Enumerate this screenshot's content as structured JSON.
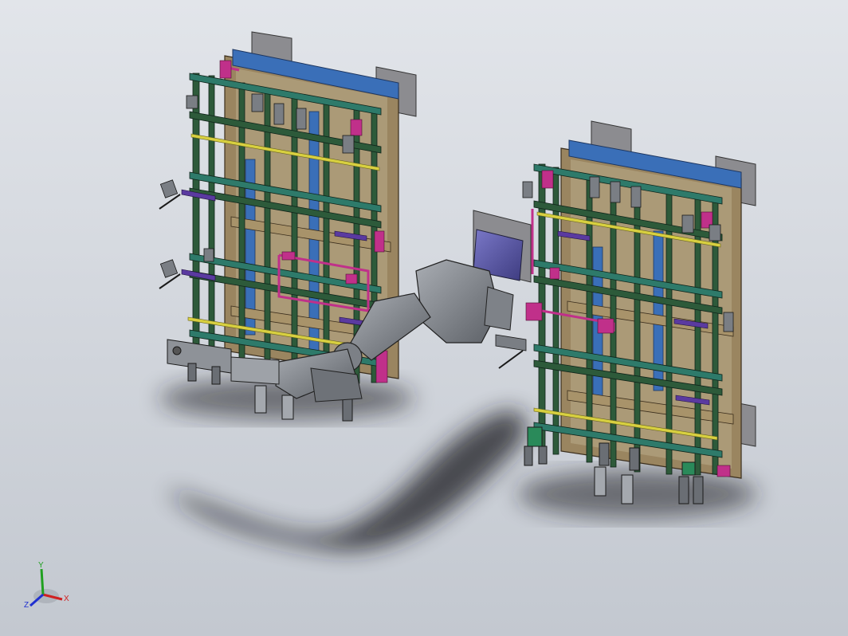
{
  "viewport": {
    "background_top": "#e2e5ea",
    "background_bottom": "#c3c8d0"
  },
  "colors": {
    "frame_green": "#2d5a3a",
    "frame_teal": "#2e7a6a",
    "beam_blue": "#3a6fb8",
    "beam_tan": "#9a8560",
    "accent_magenta": "#c0308a",
    "accent_yellow": "#d8d040",
    "robot_gray": "#8a8e94",
    "motor_purple": "#5a58a8",
    "plate_gray": "#8c8c90"
  },
  "model": {
    "left_fixture": "left-welding-fixture",
    "right_fixture": "right-welding-fixture",
    "robot": "industrial-robot-arm"
  },
  "triad": {
    "x_label": "X",
    "y_label": "Y",
    "z_label": "Z",
    "x_color": "#d02020",
    "y_color": "#20a020",
    "z_color": "#2030d0"
  }
}
